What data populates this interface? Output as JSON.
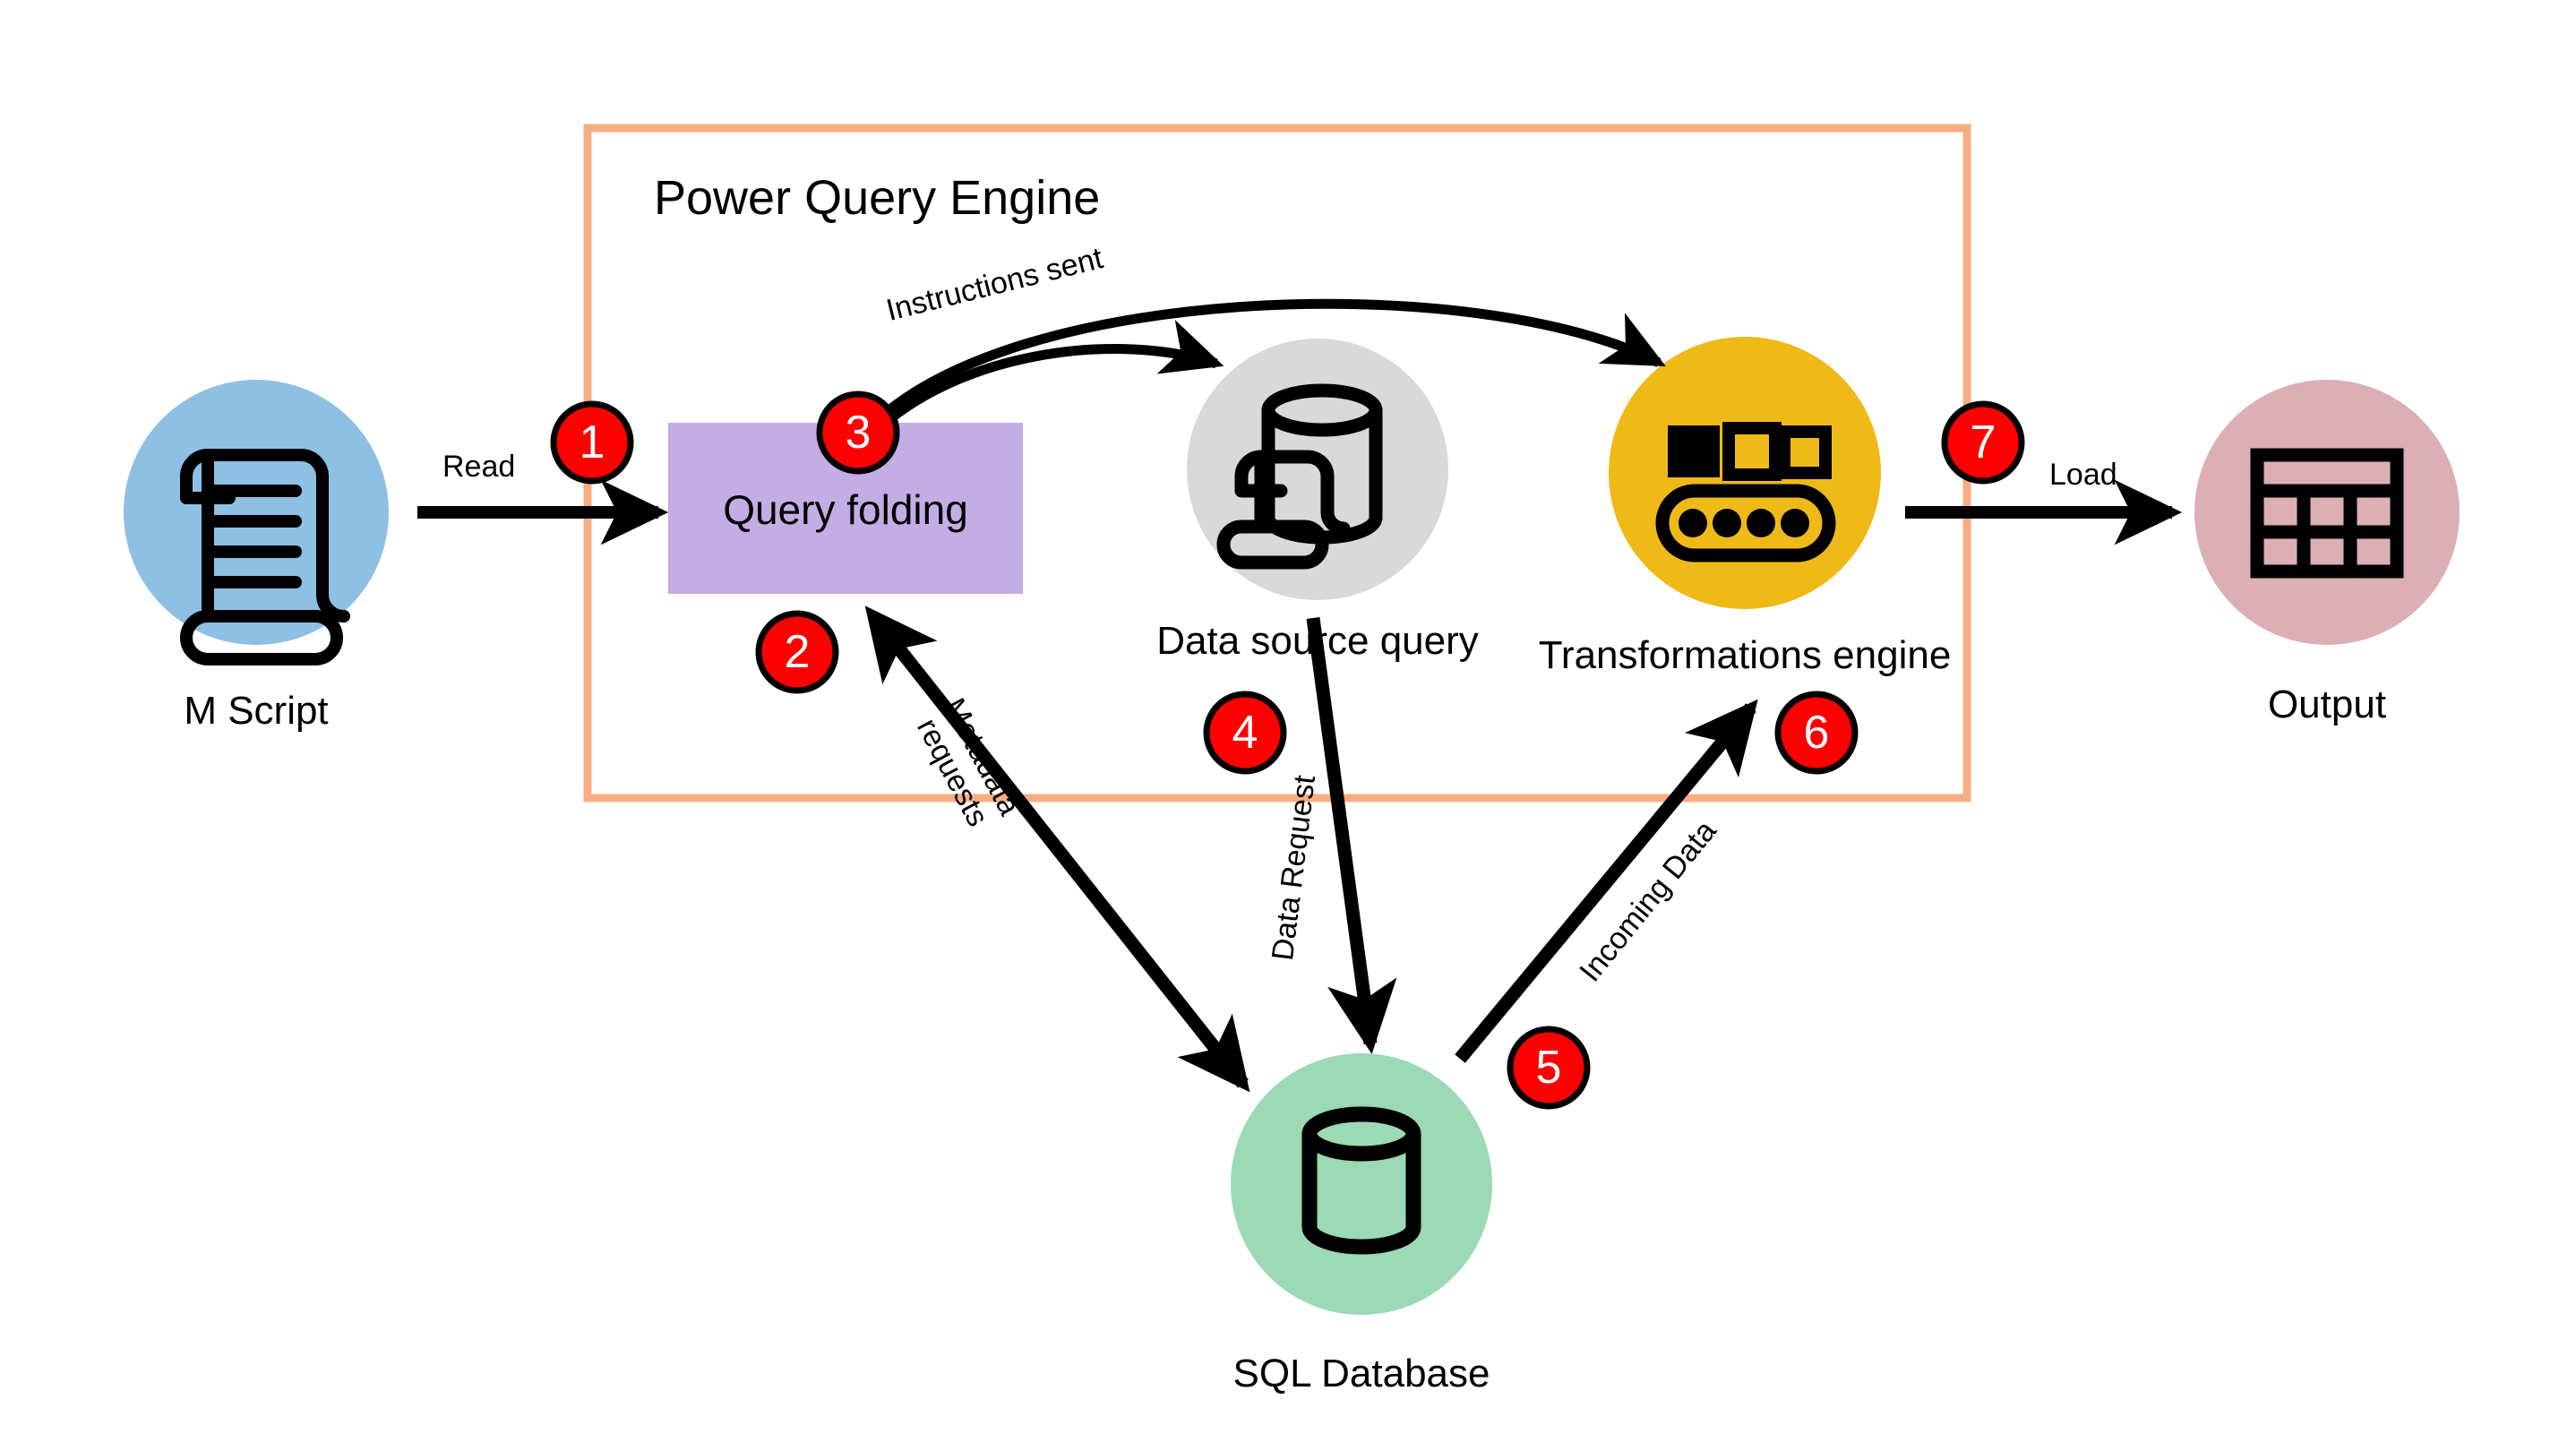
{
  "diagram": {
    "title": "Power Query Engine",
    "frame_color": "#F7AD82",
    "badge_color": "#FF0000",
    "badge_text_color": "#FFFFFF",
    "arrow_color": "#000000",
    "background": "#FFFFFF"
  },
  "nodes": {
    "m_script": {
      "label": "M Script",
      "color": "#8EC0E4",
      "icon": "scroll-icon"
    },
    "query_folding": {
      "label": "Query folding",
      "color": "#C4ACE4"
    },
    "data_source_query": {
      "label": "Data source query",
      "color": "#D9D9D9",
      "icon": "database-query-icon"
    },
    "transformations_engine": {
      "label": "Transformations engine",
      "color": "#EFBA17",
      "icon": "conveyor-belt-icon"
    },
    "output": {
      "label": "Output",
      "color": "#DCAFB4",
      "icon": "table-grid-icon"
    },
    "sql_database": {
      "label": "SQL Database",
      "color": "#9CD9B5",
      "icon": "database-cylinder-icon"
    }
  },
  "edges": [
    {
      "id": "read",
      "label": "Read",
      "badge": "1"
    },
    {
      "id": "metadata_requests",
      "label": "Metadata requests",
      "badge": "2"
    },
    {
      "id": "instructions_sent",
      "label": "Instructions sent",
      "badge": "3"
    },
    {
      "id": "data_request",
      "label": "Data Request",
      "badge": "4"
    },
    {
      "id": "incoming_data",
      "label": "Incoming Data",
      "badge": "5"
    },
    {
      "id": "incoming_data_end",
      "label": "",
      "badge": "6"
    },
    {
      "id": "load",
      "label": "Load",
      "badge": "7"
    }
  ],
  "badges": {
    "b1": "1",
    "b2": "2",
    "b3": "3",
    "b4": "4",
    "b5": "5",
    "b6": "6",
    "b7": "7"
  },
  "edge_labels": {
    "read": "Read",
    "instructions_sent": "Instructions sent",
    "metadata_line1": "Metadata",
    "metadata_line2": "requests",
    "data_request": "Data Request",
    "incoming_data": "Incoming Data",
    "load": "Load"
  }
}
